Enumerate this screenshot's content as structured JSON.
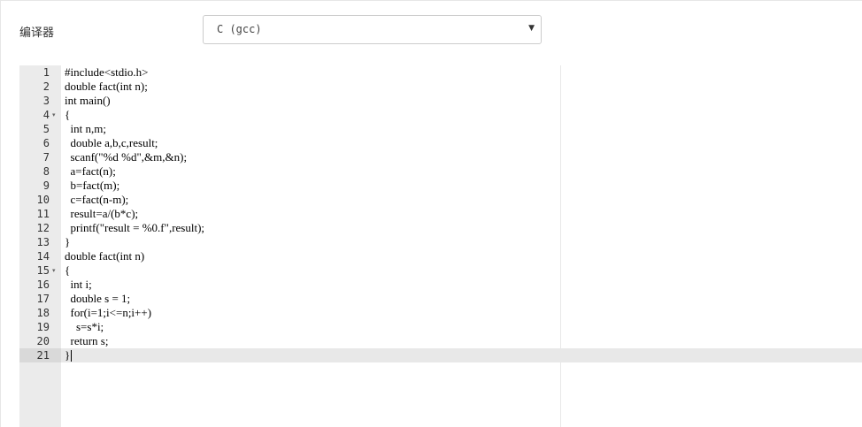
{
  "compiler": {
    "label": "编译器",
    "selected": "C (gcc)",
    "caret": "▼"
  },
  "editor": {
    "lines": [
      {
        "num": "1",
        "fold": "",
        "code": "#include<stdio.h>"
      },
      {
        "num": "2",
        "fold": "",
        "code": "double fact(int n);"
      },
      {
        "num": "3",
        "fold": "",
        "code": "int main()"
      },
      {
        "num": "4",
        "fold": "▾",
        "code": "{"
      },
      {
        "num": "5",
        "fold": "",
        "code": "  int n,m;"
      },
      {
        "num": "6",
        "fold": "",
        "code": "  double a,b,c,result;"
      },
      {
        "num": "7",
        "fold": "",
        "code": "  scanf(\"%d %d\",&m,&n);"
      },
      {
        "num": "8",
        "fold": "",
        "code": "  a=fact(n);"
      },
      {
        "num": "9",
        "fold": "",
        "code": "  b=fact(m);"
      },
      {
        "num": "10",
        "fold": "",
        "code": "  c=fact(n-m);"
      },
      {
        "num": "11",
        "fold": "",
        "code": "  result=a/(b*c);"
      },
      {
        "num": "12",
        "fold": "",
        "code": "  printf(\"result = %0.f\",result);"
      },
      {
        "num": "13",
        "fold": "",
        "code": "}"
      },
      {
        "num": "14",
        "fold": "",
        "code": "double fact(int n)"
      },
      {
        "num": "15",
        "fold": "▾",
        "code": "{"
      },
      {
        "num": "16",
        "fold": "",
        "code": "  int i;"
      },
      {
        "num": "17",
        "fold": "",
        "code": "  double s = 1;"
      },
      {
        "num": "18",
        "fold": "",
        "code": "  for(i=1;i<=n;i++)"
      },
      {
        "num": "19",
        "fold": "",
        "code": "    s=s*i;"
      },
      {
        "num": "20",
        "fold": "",
        "code": "  return s;"
      },
      {
        "num": "21",
        "fold": "",
        "code": "}"
      }
    ],
    "active_line": "21"
  }
}
